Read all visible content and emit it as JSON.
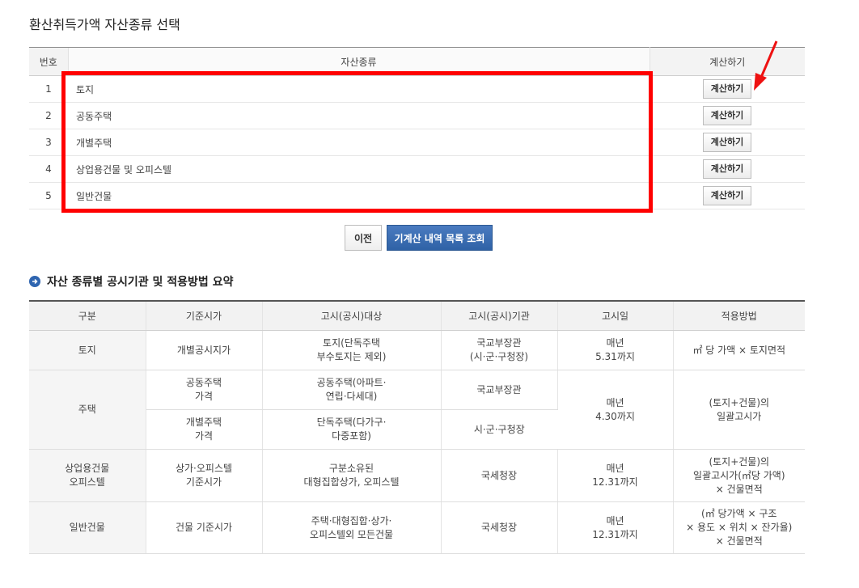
{
  "page_title": "환산취득가액 자산종류 선택",
  "asset_table": {
    "headers": {
      "num": "번호",
      "type": "자산종류",
      "action": "계산하기"
    },
    "rows": [
      {
        "num": "1",
        "name": "토지",
        "button": "계산하기"
      },
      {
        "num": "2",
        "name": "공동주택",
        "button": "계산하기"
      },
      {
        "num": "3",
        "name": "개별주택",
        "button": "계산하기"
      },
      {
        "num": "4",
        "name": "상업용건물 및 오피스텔",
        "button": "계산하기"
      },
      {
        "num": "5",
        "name": "일반건물",
        "button": "계산하기"
      }
    ]
  },
  "buttons": {
    "prev": "이전",
    "history": "기계산 내역 목록 조회"
  },
  "summary": {
    "title": "자산 종류별 공시기관 및 적용방법 요약",
    "headers": [
      "구분",
      "기준시가",
      "고시(공시)대상",
      "고시(공시)기관",
      "고시일",
      "적용방법"
    ],
    "land": {
      "cat": "토지",
      "basis": "개별공시지가",
      "target": [
        "토지(단독주택",
        "부수토지는 제외)"
      ],
      "agency": [
        "국교부장관",
        "(시·군·구청장)"
      ],
      "date": [
        "매년",
        "5.31까지"
      ],
      "method": "㎡ 당 가액 × 토지면적"
    },
    "housing": {
      "cat": "주택",
      "r1": {
        "basis": [
          "공동주택",
          "가격"
        ],
        "target": [
          "공동주택(아파트·",
          "연립·다세대)"
        ],
        "agency": "국교부장관"
      },
      "r2": {
        "basis": [
          "개별주택",
          "가격"
        ],
        "target": [
          "단독주택(다가구·",
          "다중포함)"
        ],
        "agency": "시·군·구청장"
      },
      "date": [
        "매년",
        "4.30까지"
      ],
      "method": [
        "(토지+건물)의",
        "일괄고시가"
      ]
    },
    "commercial": {
      "cat": [
        "상업용건물",
        "오피스텔"
      ],
      "basis": [
        "상가·오피스텔",
        "기준시가"
      ],
      "target": [
        "구분소유된",
        "대형집합상가, 오피스텔"
      ],
      "agency": "국세청장",
      "date": [
        "매년",
        "12.31까지"
      ],
      "method": [
        "(토지+건물)의",
        "일괄고시가(㎡당 가액)",
        "× 건물면적"
      ]
    },
    "general": {
      "cat": "일반건물",
      "basis": "건물 기준시가",
      "target": [
        "주택·대형집합·상가·",
        "오피스텔외 모든건물"
      ],
      "agency": "국세청장",
      "date": [
        "매년",
        "12.31까지"
      ],
      "method": [
        "(㎡ 당가액 × 구조",
        "× 용도 × 위치 × 잔가율)",
        "× 건물면적"
      ]
    }
  },
  "colors": {
    "highlight_border": "#ff0000",
    "arrow": "#ee1111",
    "primary_button": "#3568ad",
    "section_icon": "#2f65b0"
  },
  "icons": {
    "arrow": "red-arrow-icon",
    "section": "circle-arrow-icon"
  }
}
